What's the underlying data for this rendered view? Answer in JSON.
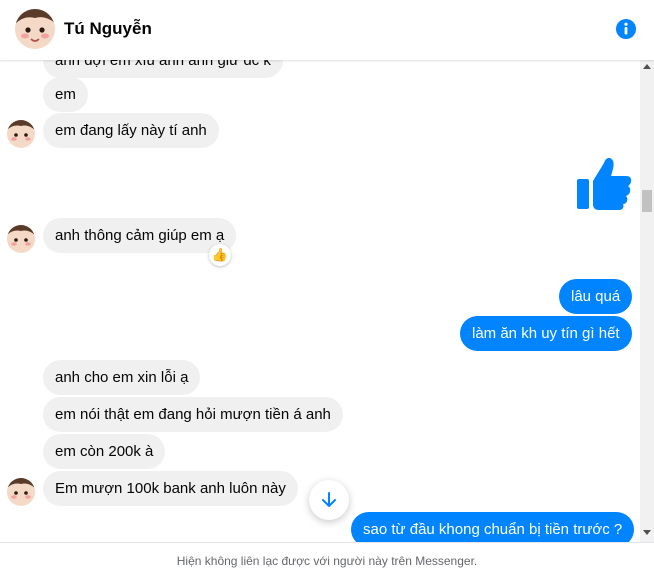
{
  "header": {
    "contact_name": "Tú Nguyễn",
    "info_icon": "info-icon"
  },
  "messages": {
    "m0": "anh đợi em xíu anh anh giữ đc k",
    "m1": "em",
    "m2": "em đang lấy này tí anh",
    "m3": "anh thông cảm giúp em ạ",
    "m3_reaction": "👍",
    "m4": "lâu quá",
    "m5": "làm ăn kh uy tín gì hết",
    "m6": "anh cho em xin lỗi ạ",
    "m7": "em nói thật em đang hỏi mượn tiền á anh",
    "m8": "em còn 200k à",
    "m9": "Em mượn 100k bank anh luôn này",
    "m10": "sao từ đầu khong chuẩn bị tiền trước ?"
  },
  "sent_sticker": "thumbs-up-icon",
  "footer": {
    "notice": "Hiện không liên lạc được với người này trên Messenger."
  },
  "colors": {
    "accent": "#0084ff",
    "incoming_bubble": "#f0f0f0"
  }
}
